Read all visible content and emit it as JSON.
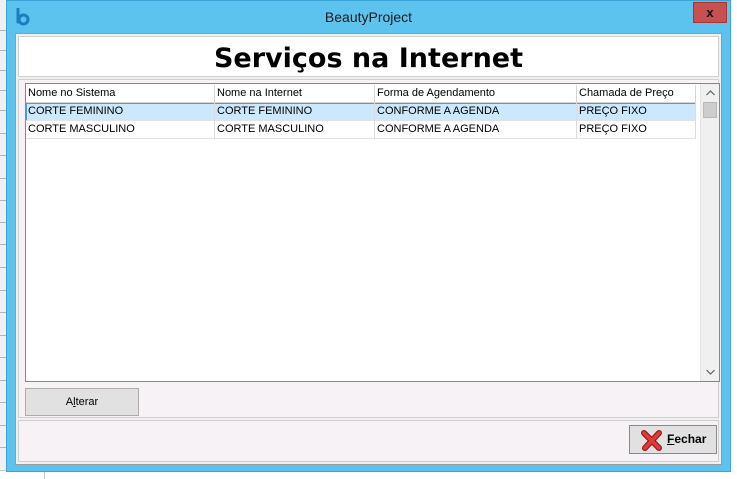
{
  "window": {
    "title": "BeautyProject",
    "close_label": "x",
    "accent_color": "#5bc3ee"
  },
  "header": {
    "title": "Serviços na Internet"
  },
  "table": {
    "columns": [
      "Nome no Sistema",
      "Nome na Internet",
      "Forma de Agendamento",
      "Chamada de Preço"
    ],
    "rows": [
      [
        "CORTE FEMININO",
        "CORTE FEMININO",
        "CONFORME A AGENDA",
        "PREÇO FIXO"
      ],
      [
        "CORTE MASCULINO",
        "CORTE MASCULINO",
        "CONFORME A AGENDA",
        "PREÇO FIXO"
      ]
    ],
    "selected_row": 0,
    "selection_color": "#cce8ff"
  },
  "buttons": {
    "alterar_prefix": "A",
    "alterar_mnemonic": "l",
    "alterar_rest": "terar",
    "fechar_mnemonic": "F",
    "fechar_rest": "echar"
  },
  "icons": {
    "app": "beauty-logo-icon",
    "close": "close-icon",
    "fechar": "red-x-icon",
    "scroll_up": "chevron-up-icon",
    "scroll_down": "chevron-down-icon"
  }
}
